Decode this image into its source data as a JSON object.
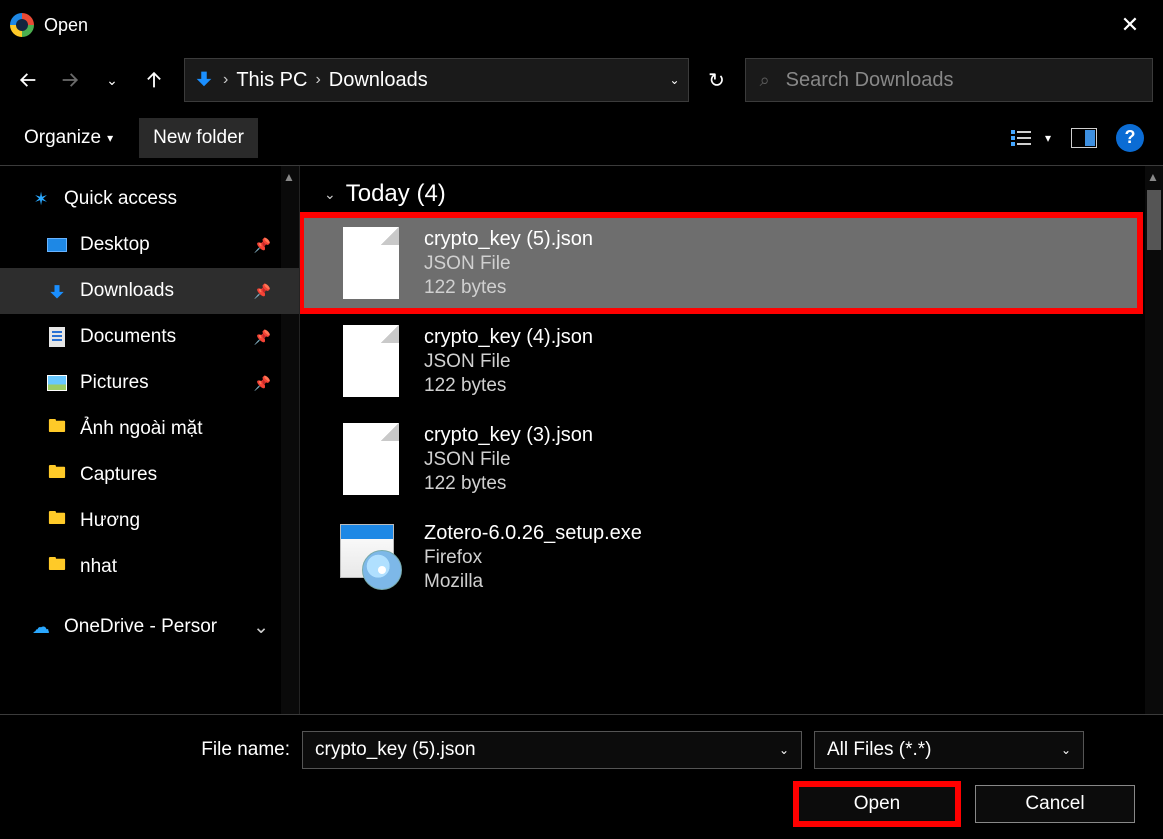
{
  "window": {
    "title": "Open"
  },
  "nav": {
    "breadcrumb": [
      {
        "label": "This PC"
      },
      {
        "label": "Downloads"
      }
    ],
    "refresh_tooltip": "Refresh",
    "search_placeholder": "Search Downloads"
  },
  "toolbar": {
    "organize": "Organize",
    "new_folder": "New folder",
    "help": "?"
  },
  "sidebar": {
    "quick_access": "Quick access",
    "items": [
      {
        "label": "Desktop",
        "pinned": true
      },
      {
        "label": "Downloads",
        "pinned": true,
        "selected": true
      },
      {
        "label": "Documents",
        "pinned": true
      },
      {
        "label": "Pictures",
        "pinned": true
      },
      {
        "label": "Ảnh ngoài mặt"
      },
      {
        "label": "Captures"
      },
      {
        "label": "Hương"
      },
      {
        "label": "nhat"
      }
    ],
    "onedrive": "OneDrive - Persor"
  },
  "files": {
    "group_label": "Today (4)",
    "rows": [
      {
        "name": "crypto_key (5).json",
        "type": "JSON File",
        "size": "122 bytes",
        "icon": "doc",
        "selected": true,
        "highlighted": true
      },
      {
        "name": "crypto_key (4).json",
        "type": "JSON File",
        "size": "122 bytes",
        "icon": "doc"
      },
      {
        "name": "crypto_key (3).json",
        "type": "JSON File",
        "size": "122 bytes",
        "icon": "doc"
      },
      {
        "name": "Zotero-6.0.26_setup.exe",
        "type": "Firefox",
        "size": "Mozilla",
        "icon": "exe"
      }
    ]
  },
  "footer": {
    "file_name_label": "File name:",
    "file_name_value": "crypto_key (5).json",
    "filter": "All Files (*.*)",
    "open": "Open",
    "cancel": "Cancel"
  }
}
